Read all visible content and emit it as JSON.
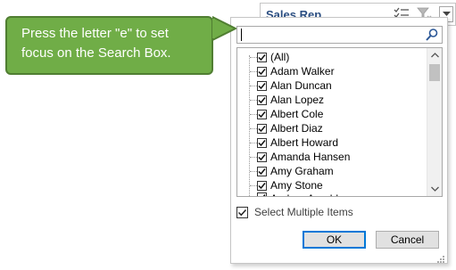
{
  "header": {
    "title": "Sales Rep",
    "icons": [
      "multi-select-icon",
      "clear-filter-icon",
      "dropdown-arrow-icon"
    ]
  },
  "callout": {
    "line1": "Press the letter \"e\" to set",
    "line2": "focus on the Search Box."
  },
  "search": {
    "value": "",
    "placeholder": ""
  },
  "list": {
    "items": [
      {
        "label": "(All)",
        "checked": true
      },
      {
        "label": "Adam Walker",
        "checked": true
      },
      {
        "label": "Alan Duncan",
        "checked": true
      },
      {
        "label": "Alan Lopez",
        "checked": true
      },
      {
        "label": "Albert Cole",
        "checked": true
      },
      {
        "label": "Albert Diaz",
        "checked": true
      },
      {
        "label": "Albert Howard",
        "checked": true
      },
      {
        "label": "Amanda Hansen",
        "checked": true
      },
      {
        "label": "Amy Graham",
        "checked": true
      },
      {
        "label": "Amy Stone",
        "checked": true
      },
      {
        "label": "Andrea Arnold",
        "checked": true
      }
    ]
  },
  "multi_select": {
    "label": "Select Multiple Items",
    "checked": true
  },
  "buttons": {
    "ok": "OK",
    "cancel": "Cancel"
  },
  "colors": {
    "callout_fill": "#70ad47",
    "callout_border": "#507e32",
    "header_title": "#2b4e81",
    "ok_focus": "#0078d7"
  }
}
